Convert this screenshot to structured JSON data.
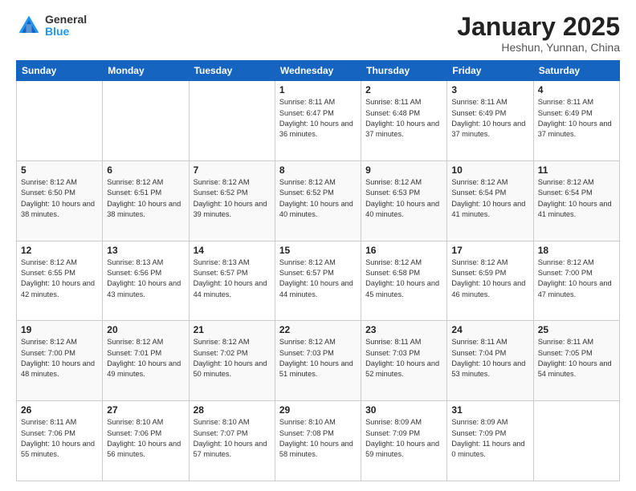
{
  "header": {
    "logo_general": "General",
    "logo_blue": "Blue",
    "title": "January 2025",
    "location": "Heshun, Yunnan, China"
  },
  "days_of_week": [
    "Sunday",
    "Monday",
    "Tuesday",
    "Wednesday",
    "Thursday",
    "Friday",
    "Saturday"
  ],
  "weeks": [
    [
      {
        "day": "",
        "sunrise": "",
        "sunset": "",
        "daylight": ""
      },
      {
        "day": "",
        "sunrise": "",
        "sunset": "",
        "daylight": ""
      },
      {
        "day": "",
        "sunrise": "",
        "sunset": "",
        "daylight": ""
      },
      {
        "day": "1",
        "sunrise": "Sunrise: 8:11 AM",
        "sunset": "Sunset: 6:47 PM",
        "daylight": "Daylight: 10 hours and 36 minutes."
      },
      {
        "day": "2",
        "sunrise": "Sunrise: 8:11 AM",
        "sunset": "Sunset: 6:48 PM",
        "daylight": "Daylight: 10 hours and 37 minutes."
      },
      {
        "day": "3",
        "sunrise": "Sunrise: 8:11 AM",
        "sunset": "Sunset: 6:49 PM",
        "daylight": "Daylight: 10 hours and 37 minutes."
      },
      {
        "day": "4",
        "sunrise": "Sunrise: 8:11 AM",
        "sunset": "Sunset: 6:49 PM",
        "daylight": "Daylight: 10 hours and 37 minutes."
      }
    ],
    [
      {
        "day": "5",
        "sunrise": "Sunrise: 8:12 AM",
        "sunset": "Sunset: 6:50 PM",
        "daylight": "Daylight: 10 hours and 38 minutes."
      },
      {
        "day": "6",
        "sunrise": "Sunrise: 8:12 AM",
        "sunset": "Sunset: 6:51 PM",
        "daylight": "Daylight: 10 hours and 38 minutes."
      },
      {
        "day": "7",
        "sunrise": "Sunrise: 8:12 AM",
        "sunset": "Sunset: 6:52 PM",
        "daylight": "Daylight: 10 hours and 39 minutes."
      },
      {
        "day": "8",
        "sunrise": "Sunrise: 8:12 AM",
        "sunset": "Sunset: 6:52 PM",
        "daylight": "Daylight: 10 hours and 40 minutes."
      },
      {
        "day": "9",
        "sunrise": "Sunrise: 8:12 AM",
        "sunset": "Sunset: 6:53 PM",
        "daylight": "Daylight: 10 hours and 40 minutes."
      },
      {
        "day": "10",
        "sunrise": "Sunrise: 8:12 AM",
        "sunset": "Sunset: 6:54 PM",
        "daylight": "Daylight: 10 hours and 41 minutes."
      },
      {
        "day": "11",
        "sunrise": "Sunrise: 8:12 AM",
        "sunset": "Sunset: 6:54 PM",
        "daylight": "Daylight: 10 hours and 41 minutes."
      }
    ],
    [
      {
        "day": "12",
        "sunrise": "Sunrise: 8:12 AM",
        "sunset": "Sunset: 6:55 PM",
        "daylight": "Daylight: 10 hours and 42 minutes."
      },
      {
        "day": "13",
        "sunrise": "Sunrise: 8:13 AM",
        "sunset": "Sunset: 6:56 PM",
        "daylight": "Daylight: 10 hours and 43 minutes."
      },
      {
        "day": "14",
        "sunrise": "Sunrise: 8:13 AM",
        "sunset": "Sunset: 6:57 PM",
        "daylight": "Daylight: 10 hours and 44 minutes."
      },
      {
        "day": "15",
        "sunrise": "Sunrise: 8:12 AM",
        "sunset": "Sunset: 6:57 PM",
        "daylight": "Daylight: 10 hours and 44 minutes."
      },
      {
        "day": "16",
        "sunrise": "Sunrise: 8:12 AM",
        "sunset": "Sunset: 6:58 PM",
        "daylight": "Daylight: 10 hours and 45 minutes."
      },
      {
        "day": "17",
        "sunrise": "Sunrise: 8:12 AM",
        "sunset": "Sunset: 6:59 PM",
        "daylight": "Daylight: 10 hours and 46 minutes."
      },
      {
        "day": "18",
        "sunrise": "Sunrise: 8:12 AM",
        "sunset": "Sunset: 7:00 PM",
        "daylight": "Daylight: 10 hours and 47 minutes."
      }
    ],
    [
      {
        "day": "19",
        "sunrise": "Sunrise: 8:12 AM",
        "sunset": "Sunset: 7:00 PM",
        "daylight": "Daylight: 10 hours and 48 minutes."
      },
      {
        "day": "20",
        "sunrise": "Sunrise: 8:12 AM",
        "sunset": "Sunset: 7:01 PM",
        "daylight": "Daylight: 10 hours and 49 minutes."
      },
      {
        "day": "21",
        "sunrise": "Sunrise: 8:12 AM",
        "sunset": "Sunset: 7:02 PM",
        "daylight": "Daylight: 10 hours and 50 minutes."
      },
      {
        "day": "22",
        "sunrise": "Sunrise: 8:12 AM",
        "sunset": "Sunset: 7:03 PM",
        "daylight": "Daylight: 10 hours and 51 minutes."
      },
      {
        "day": "23",
        "sunrise": "Sunrise: 8:11 AM",
        "sunset": "Sunset: 7:03 PM",
        "daylight": "Daylight: 10 hours and 52 minutes."
      },
      {
        "day": "24",
        "sunrise": "Sunrise: 8:11 AM",
        "sunset": "Sunset: 7:04 PM",
        "daylight": "Daylight: 10 hours and 53 minutes."
      },
      {
        "day": "25",
        "sunrise": "Sunrise: 8:11 AM",
        "sunset": "Sunset: 7:05 PM",
        "daylight": "Daylight: 10 hours and 54 minutes."
      }
    ],
    [
      {
        "day": "26",
        "sunrise": "Sunrise: 8:11 AM",
        "sunset": "Sunset: 7:06 PM",
        "daylight": "Daylight: 10 hours and 55 minutes."
      },
      {
        "day": "27",
        "sunrise": "Sunrise: 8:10 AM",
        "sunset": "Sunset: 7:06 PM",
        "daylight": "Daylight: 10 hours and 56 minutes."
      },
      {
        "day": "28",
        "sunrise": "Sunrise: 8:10 AM",
        "sunset": "Sunset: 7:07 PM",
        "daylight": "Daylight: 10 hours and 57 minutes."
      },
      {
        "day": "29",
        "sunrise": "Sunrise: 8:10 AM",
        "sunset": "Sunset: 7:08 PM",
        "daylight": "Daylight: 10 hours and 58 minutes."
      },
      {
        "day": "30",
        "sunrise": "Sunrise: 8:09 AM",
        "sunset": "Sunset: 7:09 PM",
        "daylight": "Daylight: 10 hours and 59 minutes."
      },
      {
        "day": "31",
        "sunrise": "Sunrise: 8:09 AM",
        "sunset": "Sunset: 7:09 PM",
        "daylight": "Daylight: 11 hours and 0 minutes."
      },
      {
        "day": "",
        "sunrise": "",
        "sunset": "",
        "daylight": ""
      }
    ]
  ]
}
